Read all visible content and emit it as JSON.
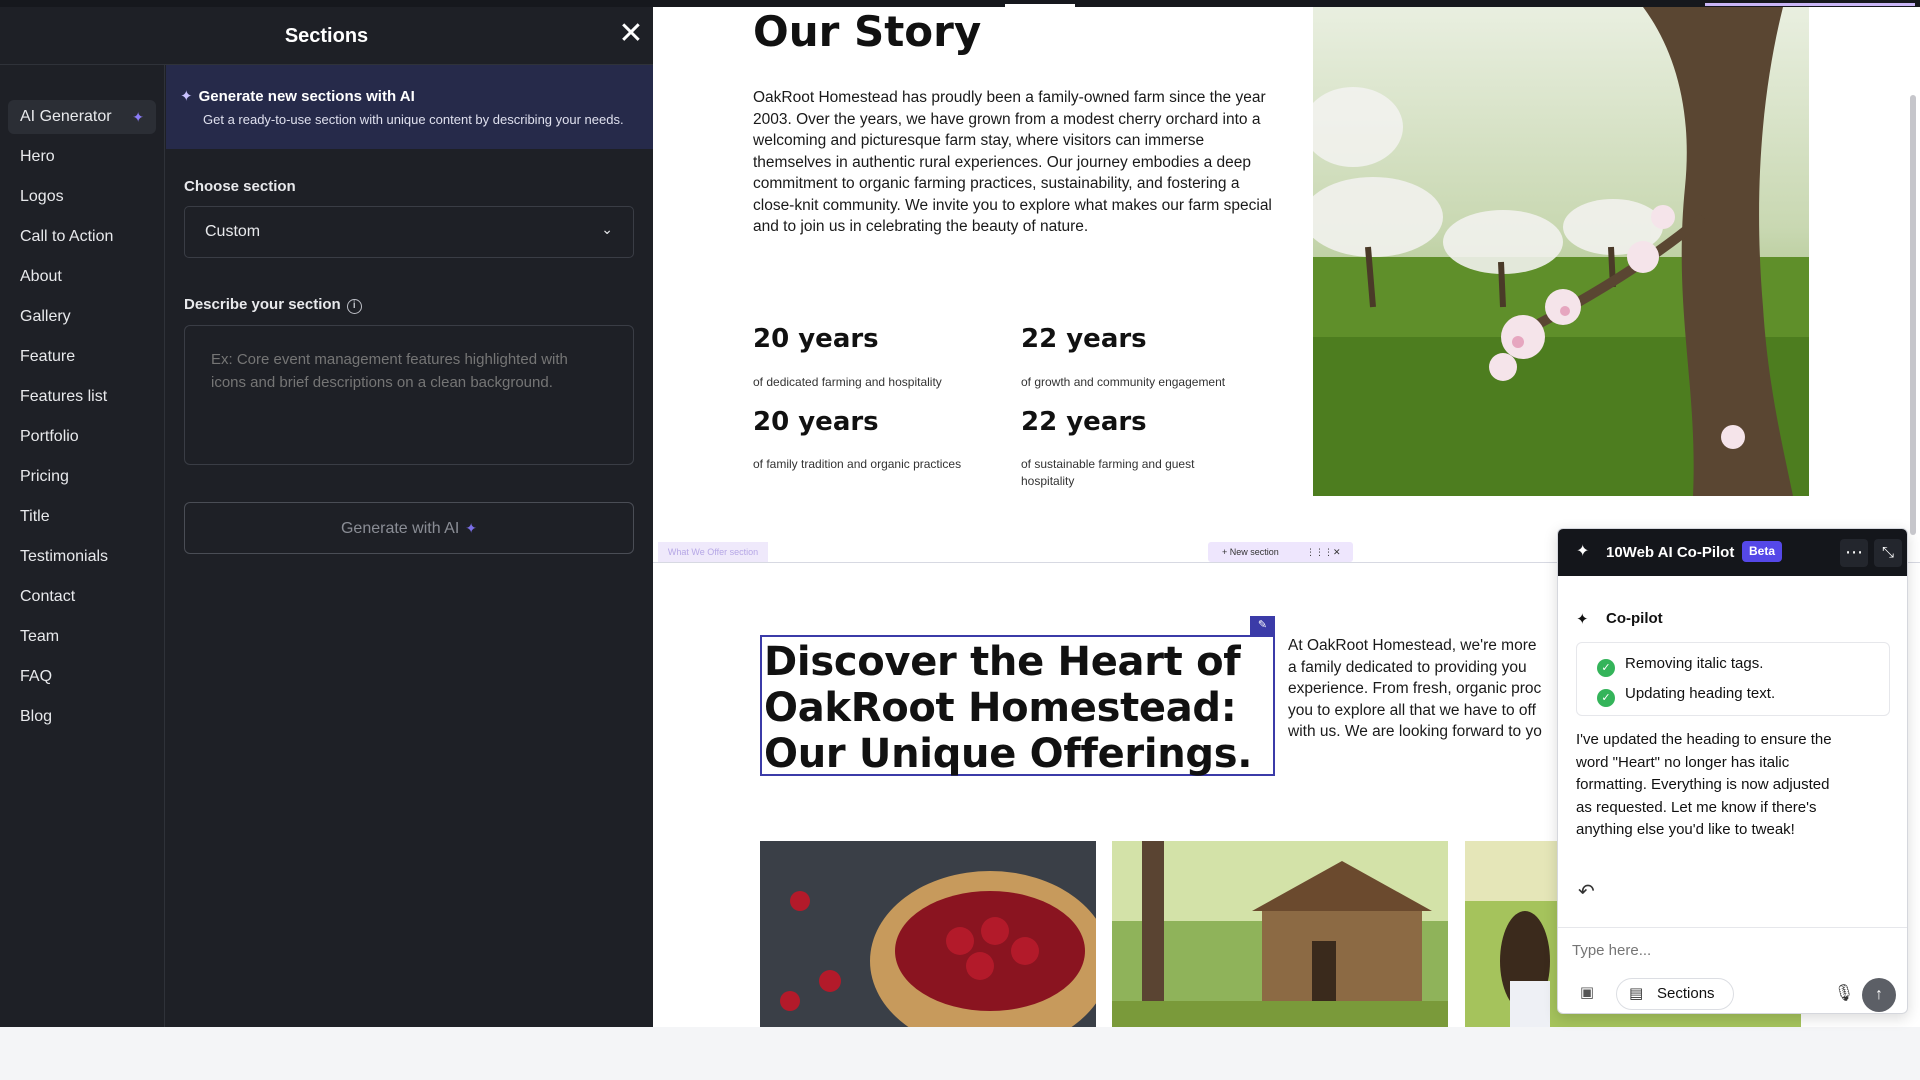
{
  "sidebar": {
    "title": "Sections",
    "items": [
      {
        "label": "AI Generator"
      },
      {
        "label": "Hero"
      },
      {
        "label": "Logos"
      },
      {
        "label": "Call to Action"
      },
      {
        "label": "About"
      },
      {
        "label": "Gallery"
      },
      {
        "label": "Feature"
      },
      {
        "label": "Features list"
      },
      {
        "label": "Portfolio"
      },
      {
        "label": "Pricing"
      },
      {
        "label": "Title"
      },
      {
        "label": "Testimonials"
      },
      {
        "label": "Contact"
      },
      {
        "label": "Team"
      },
      {
        "label": "FAQ"
      },
      {
        "label": "Blog"
      }
    ]
  },
  "ai_panel": {
    "banner_title": "Generate new sections with AI",
    "banner_desc": "Get a ready-to-use section with unique content by describing your needs.",
    "choose_label": "Choose section",
    "choose_value": "Custom",
    "describe_label": "Describe your section",
    "describe_placeholder": "Ex: Core event management features highlighted with icons and brief descriptions on a clean background.",
    "generate_label": "Generate with AI"
  },
  "canvas": {
    "story_title": "Our Story",
    "story_body": "OakRoot Homestead has proudly been a family-owned farm since the year 2003. Over the years, we have grown from a modest cherry orchard into a welcoming and picturesque farm stay, where visitors can immerse themselves in authentic rural experiences. Our journey embodies a deep commitment to organic farming practices, sustainability, and fostering a close-knit community. We invite you to explore what makes our farm special and to join us in celebrating the beauty of nature.",
    "stats": [
      {
        "value": "20 years",
        "desc": "of dedicated farming and hospitality"
      },
      {
        "value": "22 years",
        "desc": "of growth and community engagement"
      },
      {
        "value": "20 years",
        "desc": "of family tradition and organic practices"
      },
      {
        "value": "22 years",
        "desc": "of sustainable farming and guest hospitality"
      }
    ],
    "section_tag": "What We Offer section",
    "new_section": "+ New section",
    "offer_heading": "Discover the Heart of OakRoot Homestead: Our Unique Offerings.",
    "offer_body_lines": [
      "At OakRoot Homestead, we're more",
      "a family dedicated to providing you",
      "experience. From fresh, organic proc",
      "you to explore all that we have to off",
      "with us. We are looking forward to yo"
    ]
  },
  "copilot": {
    "title": "10Web AI Co-Pilot",
    "badge": "Beta",
    "label": "Co-pilot",
    "steps": [
      "Removing italic tags.",
      "Updating heading text."
    ],
    "message": "I've updated the heading to ensure the word \"Heart\" no longer has italic formatting. Everything is now adjusted as requested. Let me know if there's anything else you'd like to tweak!",
    "input_placeholder": "Type here...",
    "sections_button": "Sections"
  },
  "colors": {
    "panel_bg": "#1e2026",
    "accent": "#3b3ba8",
    "beta": "#5548e8",
    "ok": "#34b45a"
  }
}
